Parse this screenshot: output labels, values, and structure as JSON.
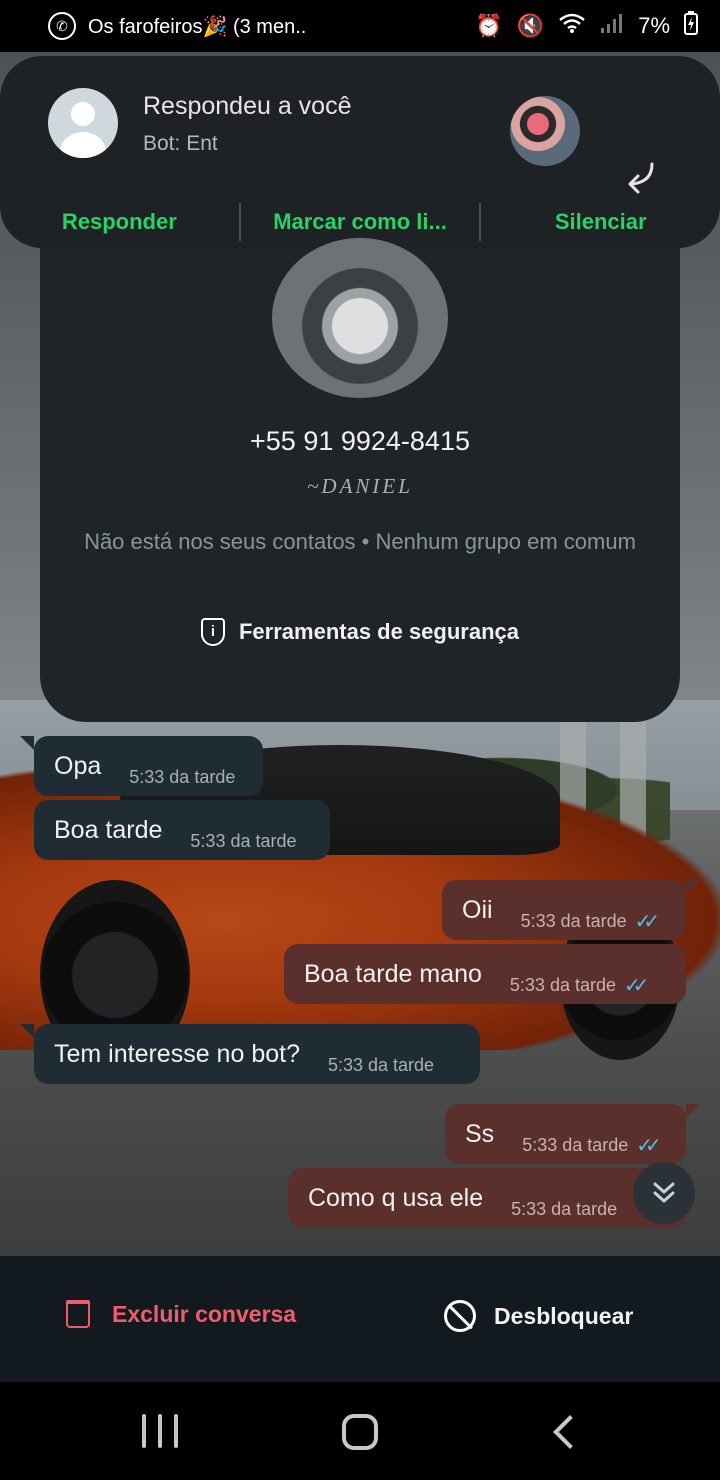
{
  "status_bar": {
    "app_title": "Os farofeiros🎉 (3 men..",
    "battery": "7%"
  },
  "notification": {
    "title": "Respondeu a você",
    "subtitle": "Bot: Ent",
    "actions": [
      "Responder",
      "Marcar como li...",
      "Silenciar"
    ]
  },
  "contact": {
    "phone": "+55 91 9924-8415",
    "nickname": "~DANIEL",
    "info": "Não está nos seus contatos • Nenhum grupo em comum",
    "safety_tools": "Ferramentas de segurança"
  },
  "messages": [
    {
      "direction": "in",
      "text": "Opa",
      "time": "5:33 da tarde"
    },
    {
      "direction": "in",
      "text": "Boa tarde",
      "time": "5:33 da tarde"
    },
    {
      "direction": "out",
      "text": "Oii",
      "time": "5:33 da tarde",
      "read": true
    },
    {
      "direction": "out",
      "text": "Boa tarde mano",
      "time": "5:33 da tarde",
      "read": true
    },
    {
      "direction": "in",
      "text": "Tem interesse no bot?",
      "time": "5:33 da tarde"
    },
    {
      "direction": "out",
      "text": "Ss",
      "time": "5:33 da tarde",
      "read": true
    },
    {
      "direction": "out",
      "text": "Como q usa ele",
      "time": "5:33 da tarde",
      "read": true
    }
  ],
  "bottom_actions": {
    "delete": "Excluir conversa",
    "unblock": "Desbloquear"
  },
  "colors": {
    "accent_green": "#25d366",
    "danger": "#f15c6d",
    "read_tick": "#53bdeb",
    "incoming_bubble": "#1f2c33",
    "outgoing_bubble": "#5a2f2c"
  }
}
